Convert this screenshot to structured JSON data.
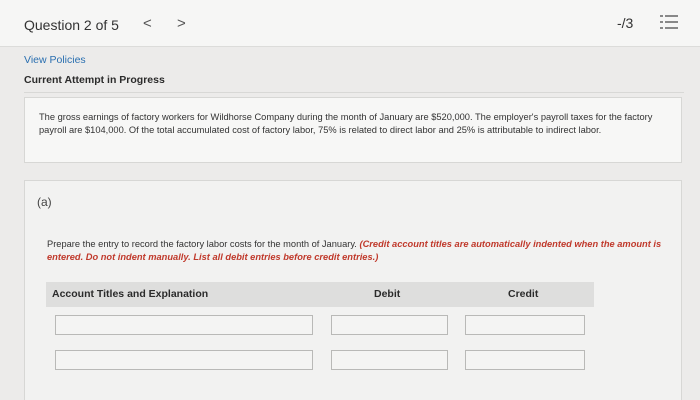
{
  "header": {
    "question_label": "Question 2 of 5",
    "prev_glyph": "<",
    "next_glyph": ">",
    "score": "-/3"
  },
  "links": {
    "view_policies": "View Policies"
  },
  "attempt_status": "Current Attempt in Progress",
  "problem_text": "The gross earnings of factory workers for Wildhorse Company during the month of January are $520,000. The employer's payroll taxes for the factory payroll are $104,000. Of the total accumulated cost of factory labor, 75% is related to direct labor and 25% is attributable to indirect labor.",
  "part": {
    "label": "(a)",
    "instruction": "Prepare the entry to record the factory labor costs for the month of January.",
    "instruction_note": "(Credit account titles are automatically indented when the amount is entered. Do not indent manually. List all debit entries before credit entries.)"
  },
  "table": {
    "headers": {
      "account": "Account Titles and Explanation",
      "debit": "Debit",
      "credit": "Credit"
    },
    "rows": [
      {
        "account": "",
        "debit": "",
        "credit": ""
      },
      {
        "account": "",
        "debit": "",
        "credit": ""
      }
    ]
  },
  "colors": {
    "link": "#2a6fb0",
    "instruction_note": "#c0392b",
    "header_bg": "#dededd"
  },
  "icons": {
    "prev": "chevron-left-icon",
    "next": "chevron-right-icon",
    "question_list": "list-icon"
  }
}
